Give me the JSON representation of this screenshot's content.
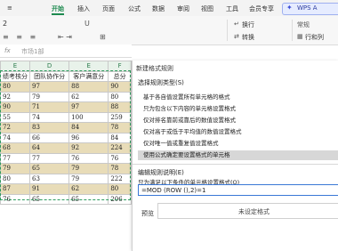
{
  "ribbon": {
    "tabs": [
      "开始",
      "插入",
      "页面",
      "公式",
      "数据",
      "审阅",
      "视图",
      "工具",
      "会员专享",
      "效率"
    ],
    "active_tab": "开始",
    "wps_label": "WPS A"
  },
  "toolbar": {
    "font_size_fragment": "2",
    "wrap_label": "换行",
    "convert_label": "转换",
    "rowcol_label": "行和列",
    "number_format": "常规"
  },
  "formula_bar": {
    "fx": "fx",
    "value": "市场1部"
  },
  "sheet": {
    "columns": [
      "E",
      "D",
      "E",
      "F"
    ],
    "header_row": [
      "绩考核分",
      "团队协作分",
      "客户满意分",
      "总分"
    ],
    "rows": [
      {
        "style": "tan",
        "cells": [
          "80",
          "97",
          "88",
          "90"
        ]
      },
      {
        "style": "white",
        "cells": [
          "92",
          "79",
          "62",
          "80"
        ]
      },
      {
        "style": "tan",
        "cells": [
          "90",
          "71",
          "97",
          "88"
        ]
      },
      {
        "style": "white",
        "cells": [
          "55",
          "74",
          "100",
          "259"
        ]
      },
      {
        "style": "tan",
        "cells": [
          "72",
          "83",
          "84",
          "78"
        ]
      },
      {
        "style": "white",
        "cells": [
          "74",
          "66",
          "96",
          "84"
        ]
      },
      {
        "style": "tan",
        "cells": [
          "68",
          "64",
          "92",
          "224"
        ]
      },
      {
        "style": "white",
        "cells": [
          "77",
          "77",
          "76",
          "76"
        ]
      },
      {
        "style": "tan",
        "cells": [
          "79",
          "65",
          "79",
          "78"
        ]
      },
      {
        "style": "white",
        "cells": [
          "80",
          "63",
          "79",
          "222"
        ]
      },
      {
        "style": "tan",
        "cells": [
          "87",
          "91",
          "62",
          "80"
        ]
      },
      {
        "style": "white",
        "cells": [
          "76",
          "65",
          "65",
          "206"
        ]
      }
    ]
  },
  "dialog": {
    "title": "新建格式规则",
    "select_rule_type_label": "选择规则类型(S)",
    "rule_types": [
      "基于各自值设置所有单元格的格式",
      "只为包含以下内容的单元格设置格式",
      "仅对排名靠前或靠后的数值设置格式",
      "仅对高于或低于平均值的数值设置格式",
      "仅对唯一值或重复值设置格式",
      "使用公式确定要设置格式的单元格"
    ],
    "selected_rule_index": 5,
    "edit_desc_label": "编辑规则说明(E)",
    "formula_prompt": "只为满足以下条件的单元格设置格式(O)",
    "formula_value": "=MOD (ROW (),2)=1",
    "preview_label": "预览",
    "preview_text": "未设定格式"
  },
  "colors": {
    "accent_green": "#1d8a4f",
    "row_tan": "#e8dcb8",
    "header_green": "#e8f2ea",
    "selected_rule": "#d7d7d7"
  }
}
